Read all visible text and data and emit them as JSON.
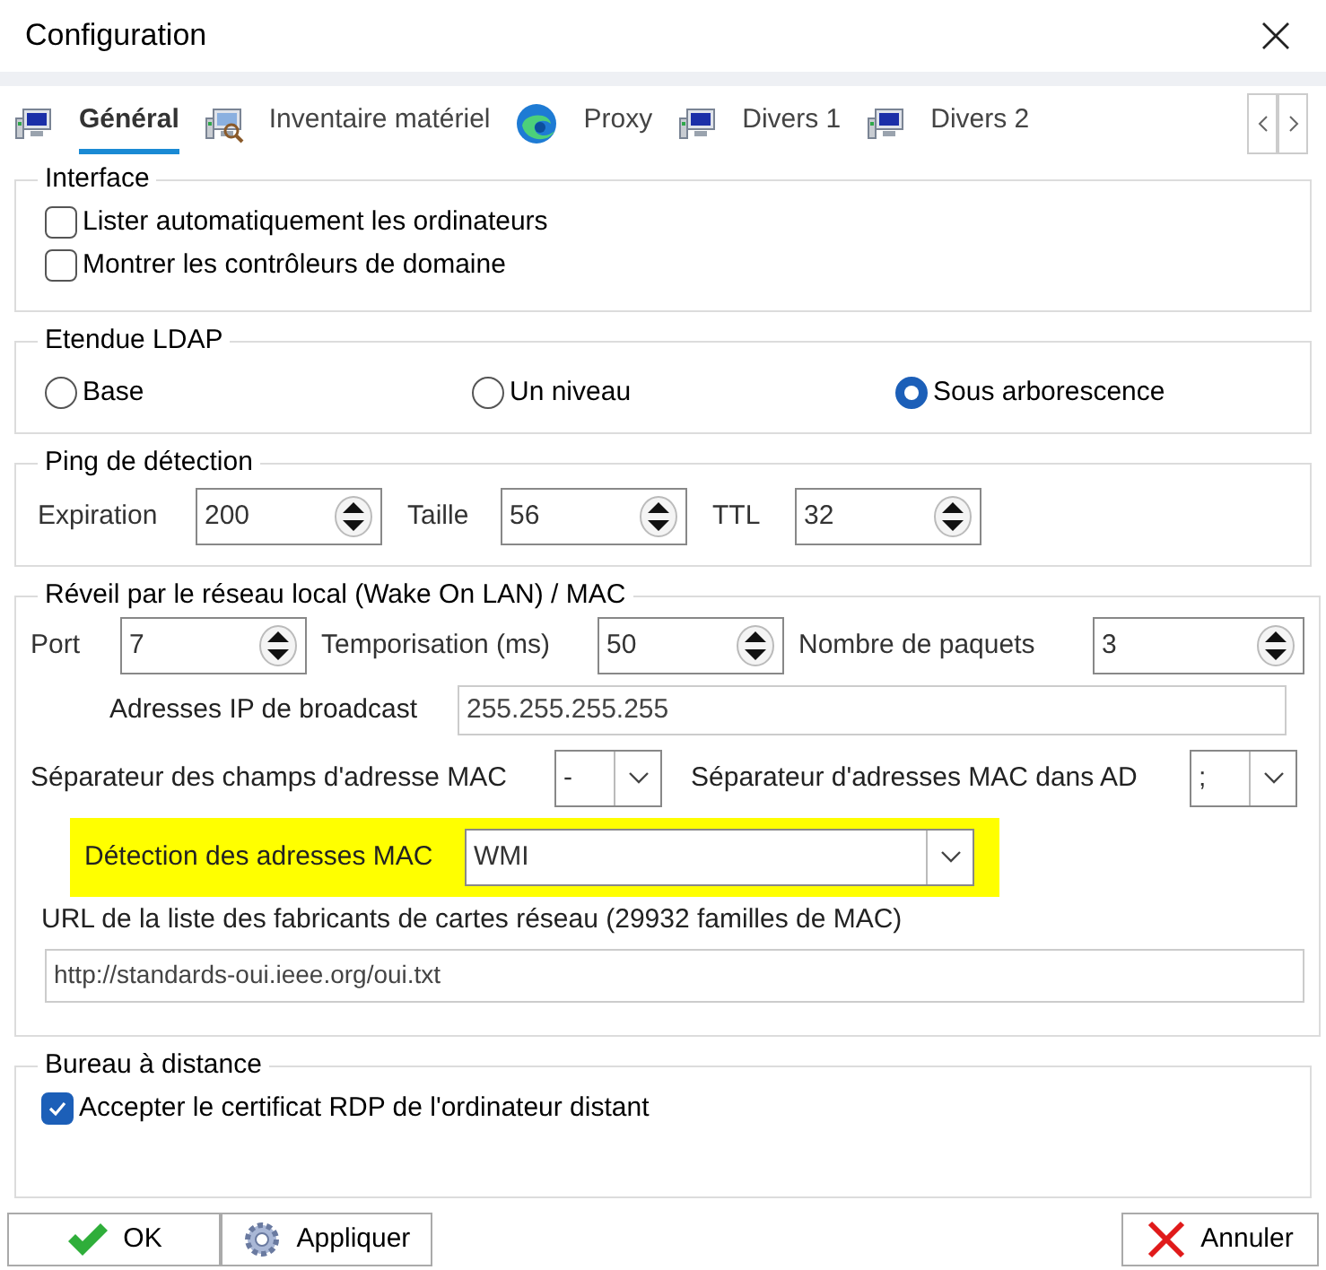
{
  "window": {
    "title": "Configuration"
  },
  "tabs": [
    {
      "label": "Général",
      "kind": "computer",
      "selected": true
    },
    {
      "label": "Inventaire matériel",
      "kind": "search",
      "selected": false
    },
    {
      "label": "Proxy",
      "kind": "browser",
      "selected": false
    },
    {
      "label": "Divers 1",
      "kind": "computer",
      "selected": false
    },
    {
      "label": "Divers 2",
      "kind": "computer",
      "selected": false
    }
  ],
  "interface": {
    "title": "Interface",
    "checkboxes": [
      {
        "label": "Lister automatiquement les ordinateurs",
        "checked": false
      },
      {
        "label": "Montrer les contrôleurs de domaine",
        "checked": false
      }
    ]
  },
  "ldap": {
    "title": "Etendue LDAP",
    "radios": [
      {
        "label": "Base",
        "selected": false
      },
      {
        "label": "Un niveau",
        "selected": false
      },
      {
        "label": "Sous arborescence",
        "selected": true
      }
    ]
  },
  "ping": {
    "title": "Ping de détection",
    "fields": [
      {
        "label": "Expiration",
        "value": "200"
      },
      {
        "label": "Taille",
        "value": "56"
      },
      {
        "label": "TTL",
        "value": "32"
      }
    ]
  },
  "wol": {
    "title": "Réveil par le réseau local (Wake On LAN)  / MAC",
    "fields": [
      {
        "label": "Port",
        "value": "7"
      },
      {
        "label": "Temporisation (ms)",
        "value": "50"
      },
      {
        "label": "Nombre de paquets",
        "value": "3"
      }
    ],
    "broadcast": {
      "label": "Adresses IP de broadcast",
      "value": "255.255.255.255"
    },
    "mac_separator": {
      "label": "Séparateur des champs d'adresse MAC",
      "value": "-"
    },
    "ad_separator": {
      "label": "Séparateur d'adresses MAC dans AD",
      "value": ";"
    },
    "detection": {
      "label": "Détection des adresses MAC",
      "value": "WMI",
      "highlighted": true
    },
    "url_label": "URL de la liste des fabricants de cartes réseau (29932 familles de MAC)",
    "url": {
      "value": "http://standards-oui.ieee.org/oui.txt"
    }
  },
  "remote": {
    "title": "Bureau à distance",
    "checkboxes": [
      {
        "label": "Accepter le certificat RDP de l'ordinateur distant",
        "checked": true
      }
    ]
  },
  "buttons": [
    {
      "label": "OK",
      "kind": "ok"
    },
    {
      "label": "Appliquer",
      "kind": "apply"
    },
    {
      "label": "Annuler",
      "kind": "cancel"
    }
  ]
}
